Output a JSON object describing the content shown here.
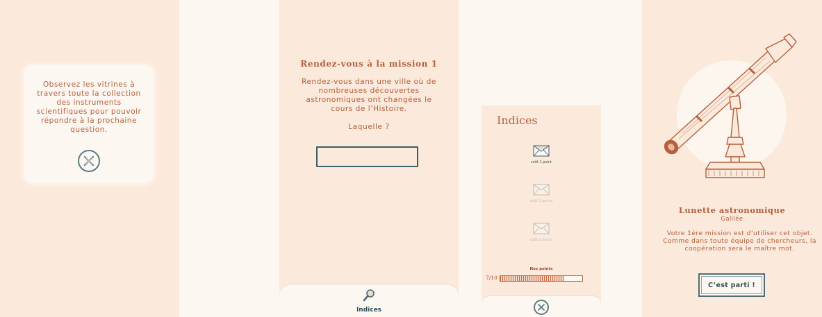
{
  "screen1": {
    "instruction": "Observez les vitrines à travers toute la collection des instruments scientifiques pour pouvoir répondre à la prochaine question."
  },
  "screen2": {
    "title": "Rendez-vous à la mission 1",
    "text": "Rendez-vous dans une ville où de nombreuses découvertes astronomiques ont changées le cours de l’Histoire.",
    "question": "Laquelle ?",
    "answer_value": "",
    "tab_label": "Indices"
  },
  "screen3": {
    "title": "Indices",
    "clues": [
      {
        "cost": "coût 1 point",
        "unlocked": true
      },
      {
        "cost": "coût 2 points",
        "unlocked": false
      },
      {
        "cost": "coût 2 points",
        "unlocked": false
      }
    ],
    "points_label": "Nos points",
    "points_value": "7/10",
    "points_fraction": 0.78
  },
  "screen4": {
    "object_title": "Lunette astronomique",
    "object_subtitle": "Galilée",
    "text": "Votre 1ère mission est d’utiliser cet objet. Comme dans toute équipe de chercheurs, la coopération sera le maître mot.",
    "button_label": "C’est parti !"
  },
  "colors": {
    "accent": "#b4603c",
    "panel": "#fbe9dc",
    "background": "#fdf7f1",
    "teal": "#3c6068"
  },
  "icons": [
    "close-icon",
    "magnifier-icon",
    "envelope-icon",
    "telescope-illustration"
  ]
}
